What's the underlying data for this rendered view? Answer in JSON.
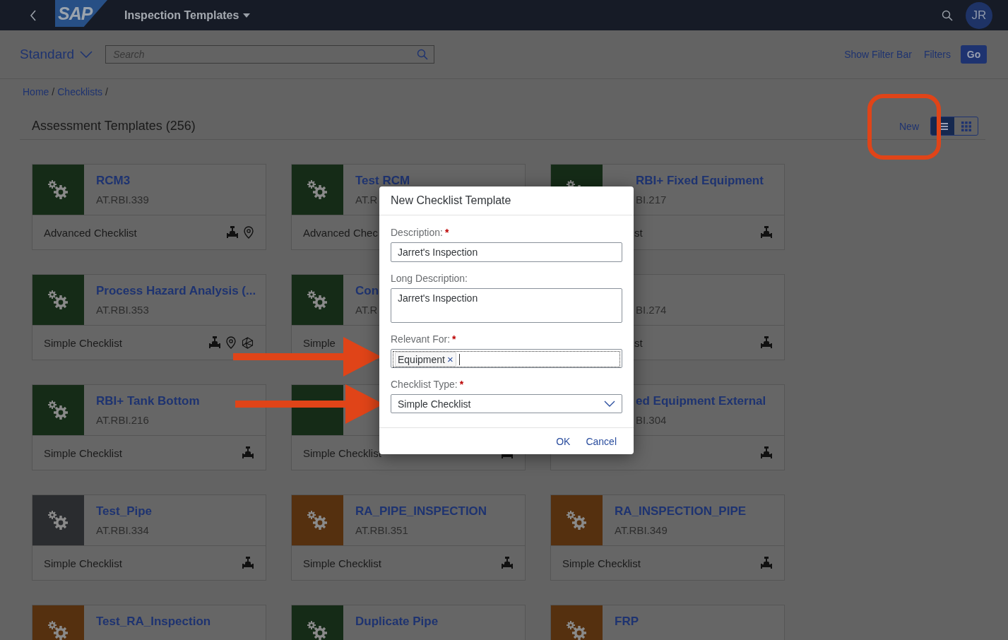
{
  "shell": {
    "logo": "SAP",
    "title": "Inspection Templates",
    "avatar": "JR"
  },
  "toolbar": {
    "variant": "Standard",
    "search_placeholder": "Search",
    "actions": [
      "Show Filter Bar",
      "Filters"
    ],
    "go": "Go"
  },
  "breadcrumbs": {
    "items": [
      "Home",
      "Checklists"
    ],
    "separator": "/"
  },
  "list": {
    "title": "Assessment Templates (256)",
    "new_label": "New",
    "view_toggle": [
      {
        "kind": "list",
        "selected": true
      },
      {
        "kind": "grid",
        "selected": false
      }
    ]
  },
  "cards": [
    {
      "title": "RCM3",
      "id": "AT.RBI.339",
      "type": "Advanced Checklist",
      "color": "#152b17",
      "clipped": false
    },
    {
      "title": "Test RCM",
      "id": "AT.R",
      "type": "Advanced Chec",
      "color": "#152b17",
      "clipped": false
    },
    {
      "title": "RBI+ Fixed Equipment",
      "id": "BI.217",
      "type": "st",
      "color": "#152b17",
      "clipped": true
    },
    {
      "title": "Process Hazard Analysis (...",
      "id": "AT.RBI.353",
      "type": "Simple Checklist",
      "color": "#152b17",
      "clipped": false
    },
    {
      "title": "Con",
      "id": "AT.R",
      "type": "Simple",
      "color": "#152b17",
      "clipped": false
    },
    {
      "id": "BI.274",
      "type": "st",
      "clipped": true
    },
    {
      "title": "RBI+ Tank Bottom",
      "id": "AT.RBI.216",
      "type": "Simple Checklist",
      "color": "#152b17",
      "clipped": false
    },
    {
      "type": "Simple Checklist",
      "color": "#152b17",
      "clipped": false
    },
    {
      "title": "ed Equipment External",
      "id": "BI.304",
      "clipped": true
    },
    {
      "title": "Test_Pipe",
      "id": "AT.RBI.334",
      "type": "Simple Checklist",
      "color": "#2a2c2f",
      "clipped": false
    },
    {
      "title": "RA_PIPE_INSPECTION",
      "id": "AT.RBI.351",
      "type": "Simple Checklist",
      "color": "#55300f",
      "clipped": false
    },
    {
      "title": "RA_INSPECTION_PIPE",
      "id": "AT.RBI.349",
      "type": "Simple Checklist",
      "color": "#55300f",
      "clipped": false
    },
    {
      "title": "Test_RA_Inspection",
      "color": "#55300f",
      "clipped": false
    },
    {
      "title": "Duplicate Pipe",
      "color": "#152b17",
      "clipped": false
    },
    {
      "title": "FRP",
      "color": "#55300f",
      "clipped": false
    }
  ],
  "dialog": {
    "title": "New Checklist Template",
    "fields": [
      {
        "kind": "input",
        "label": "Description:",
        "required": true,
        "value": "Jarret's Inspection"
      },
      {
        "kind": "textarea",
        "label": "Long Description:",
        "required": false,
        "value": "Jarret's Inspection"
      },
      {
        "kind": "tokens",
        "label": "Relevant For:",
        "required": true,
        "tokens": [
          {
            "text": "Equipment",
            "remove": "×"
          }
        ]
      },
      {
        "kind": "select",
        "label": "Checklist Type:",
        "required": true,
        "value": "Simple Checklist"
      }
    ],
    "required_mark": "*",
    "buttons": [
      "OK",
      "Cancel"
    ]
  },
  "annotations": [
    {
      "kind": "highlight"
    },
    {
      "kind": "arrow"
    },
    {
      "kind": "arrow"
    }
  ]
}
